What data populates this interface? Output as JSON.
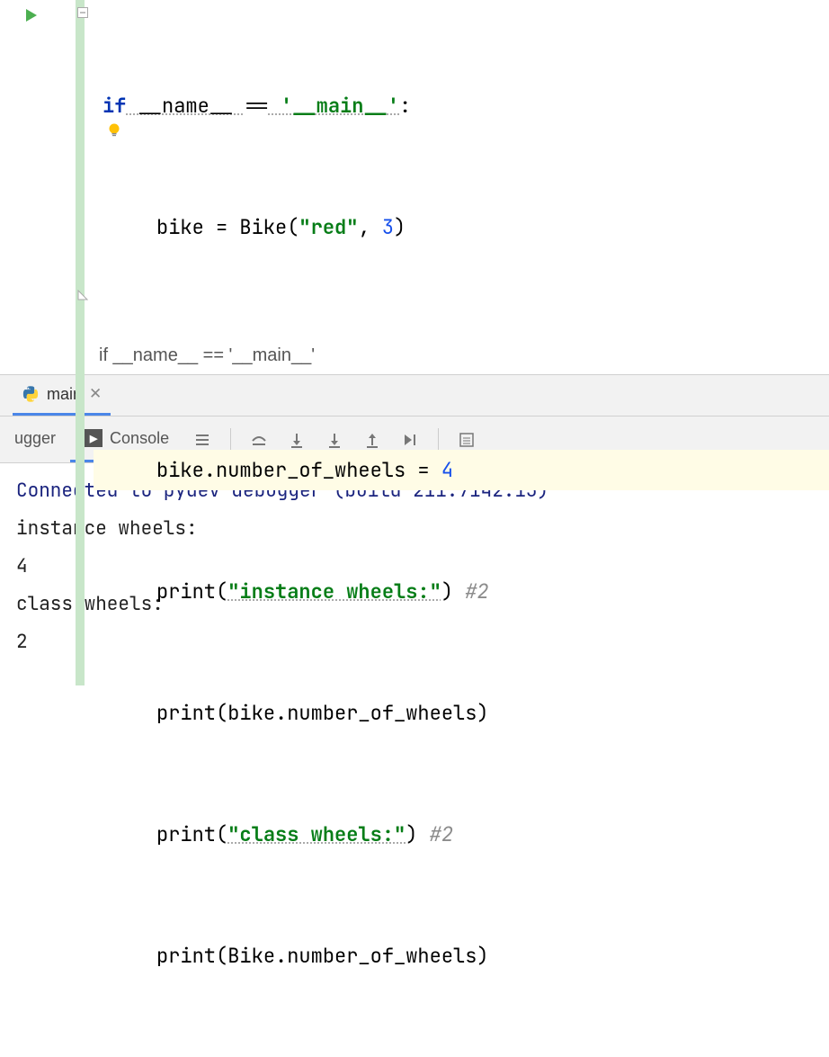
{
  "code": {
    "line1": {
      "kw_if": "if",
      "name": " __name__ ",
      "op": "==",
      "str_main": " '__main__'",
      "colon": ":"
    },
    "line2": {
      "var": "bike = ",
      "call": "Bike(",
      "str": "\"red\"",
      "comma": ", ",
      "num": "3",
      "close": ")"
    },
    "line4": {
      "lhs": "bike.number_of_wheels = ",
      "num": "4"
    },
    "line5": {
      "fn": "print",
      "open": "(",
      "str": "\"instance wheels:\"",
      "close": ")",
      "comment": " #2"
    },
    "line6": {
      "fn": "print",
      "open": "(",
      "arg": "bike.number_of_wheels",
      "close": ")"
    },
    "line7": {
      "fn": "print",
      "open": "(",
      "str": "\"class wheels:\"",
      "close": ")",
      "comment": " #2"
    },
    "line8": {
      "fn": "print",
      "open": "(",
      "arg": "Bike.number_of_wheels",
      "close": ")"
    }
  },
  "breadcrumb": "if __name__ == '__main__'",
  "tab": {
    "label": "main"
  },
  "tool_tabs": {
    "debugger": "ugger",
    "console": "Console"
  },
  "console": {
    "line1": "Connected to pydev debugger (build 211.7142.13)",
    "line2": "instance wheels:",
    "line3": "4",
    "line4": "class wheels:",
    "line5": "2"
  }
}
